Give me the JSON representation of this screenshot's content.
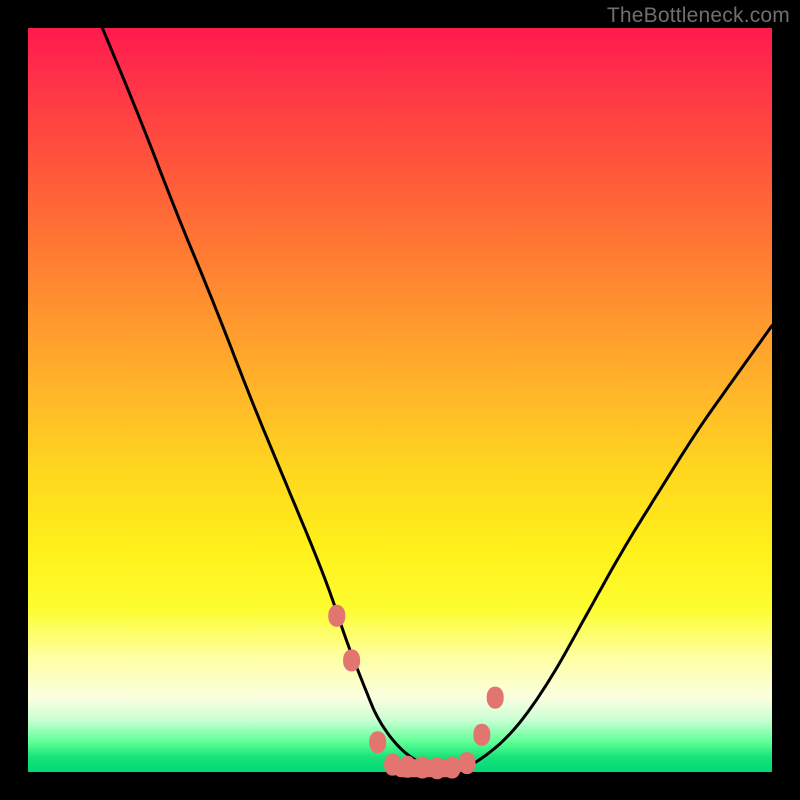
{
  "watermark": "TheBottleneck.com",
  "chart_data": {
    "type": "line",
    "title": "",
    "xlabel": "",
    "ylabel": "",
    "xlim": [
      0,
      100
    ],
    "ylim": [
      0,
      100
    ],
    "series": [
      {
        "name": "curve",
        "x": [
          10,
          15,
          20,
          25,
          30,
          35,
          40,
          43,
          45,
          47,
          50,
          53,
          55,
          57,
          60,
          65,
          70,
          75,
          80,
          85,
          90,
          95,
          100
        ],
        "values": [
          100,
          88,
          75,
          63,
          50,
          38,
          26,
          17,
          12,
          7,
          3,
          1,
          0,
          0,
          1,
          5,
          12,
          21,
          30,
          38,
          46,
          53,
          60
        ]
      }
    ],
    "markers": {
      "name": "points",
      "x": [
        41.5,
        43.5,
        47,
        49,
        51,
        53,
        55,
        57,
        59,
        61,
        62.8
      ],
      "values": [
        21,
        15,
        4,
        1,
        0.7,
        0.6,
        0.5,
        0.6,
        1.2,
        5,
        10
      ],
      "color": "#e2756f"
    },
    "colors": {
      "curve": "#000000",
      "marker": "#e2756f",
      "gradient_top": "#ff1a4c",
      "gradient_bottom": "#00d877"
    }
  }
}
